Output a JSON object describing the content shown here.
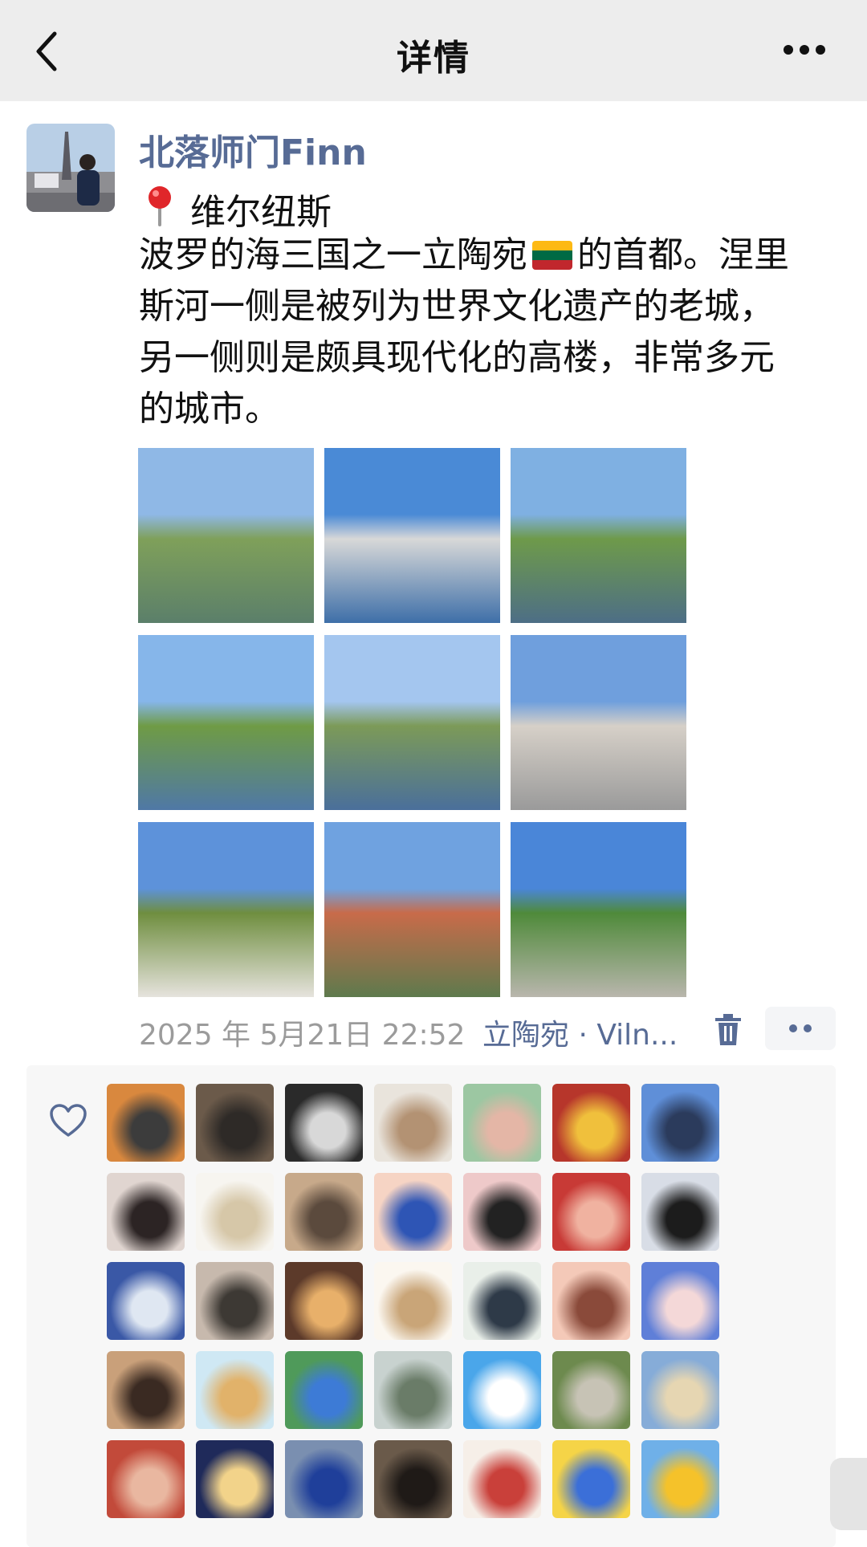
{
  "header": {
    "title": "详情"
  },
  "post": {
    "author": "北落师门Finn",
    "location": "维尔纽斯",
    "caption_lines": [
      {
        "before": "波罗的海三国之一立陶宛",
        "after": "的首都。涅里"
      },
      {
        "text": "斯河一侧是被列为世界文化遗产的老城，"
      },
      {
        "text": "另一侧则是颇具现代化的高楼，非常多元"
      },
      {
        "text": "的城市。"
      }
    ],
    "flag_colors": [
      "#fdb913",
      "#006a44",
      "#c1272d"
    ],
    "photos": [
      {
        "name": "photo-river-embankment",
        "sky": "#8fb8e6",
        "ground": "#5b7f6a",
        "accent": "#7fa05a"
      },
      {
        "name": "photo-city-skyscrapers",
        "sky": "#4a8ad6",
        "ground": "#3e6fa8",
        "accent": "#d8d8d8"
      },
      {
        "name": "photo-river-old-town",
        "sky": "#7fb0e2",
        "ground": "#4d6e86",
        "accent": "#6e9a4a"
      },
      {
        "name": "photo-river-bend",
        "sky": "#86b6ea",
        "ground": "#4f78a6",
        "accent": "#6f9b45"
      },
      {
        "name": "photo-river-reflection",
        "sky": "#a4c6ef",
        "ground": "#4a6f9b",
        "accent": "#7c9a58"
      },
      {
        "name": "photo-monument-building",
        "sky": "#6f9fdd",
        "ground": "#9a9a9a",
        "accent": "#d6d0c8"
      },
      {
        "name": "photo-castle-hill",
        "sky": "#5d92da",
        "ground": "#e6e3dd",
        "accent": "#6f8e3f"
      },
      {
        "name": "photo-city-panorama",
        "sky": "#6fa2e0",
        "ground": "#5e7a4d",
        "accent": "#c86b4a"
      },
      {
        "name": "photo-stone-sculptures",
        "sky": "#4a86d8",
        "ground": "#b9b6ad",
        "accent": "#4f8a3a"
      }
    ],
    "timestamp": "2025 年 5月21日 22:52",
    "location_link": "立陶宛 · Viln...",
    "likers": [
      [
        "#d9883e",
        "#3c3c3c"
      ],
      [
        "#6b5a4a",
        "#2e2a27"
      ],
      [
        "#2a2a2a",
        "#d8d8d8"
      ],
      [
        "#e9e4dc",
        "#b39273"
      ],
      [
        "#9cc7a2",
        "#e4b6a6"
      ],
      [
        "#b7362b",
        "#f0c03c"
      ],
      [
        "#5f8fd8",
        "#2b3b5c"
      ],
      [
        "#e0d5d0",
        "#2c2424"
      ],
      [
        "#f7f5f0",
        "#d6c7a8"
      ],
      [
        "#c7a98a",
        "#5b4a3d"
      ],
      [
        "#f6d4c4",
        "#2e55b5"
      ],
      [
        "#eec9c9",
        "#222222"
      ],
      [
        "#c83a36",
        "#f0b2a0"
      ],
      [
        "#d8dde6",
        "#1c1c1c"
      ],
      [
        "#3a58a6",
        "#dfe7f2"
      ],
      [
        "#c7b9ad",
        "#3d3934"
      ],
      [
        "#5c3a2a",
        "#e8b06a"
      ],
      [
        "#fbf7f0",
        "#c9a578"
      ],
      [
        "#e9efe9",
        "#2e3a48"
      ],
      [
        "#f4c9b8",
        "#8a4a3a"
      ],
      [
        "#5f7fd8",
        "#f4d8d8"
      ],
      [
        "#c9a07a",
        "#3a2a22"
      ],
      [
        "#cfe8f4",
        "#e1b26a"
      ],
      [
        "#4f9a5a",
        "#3d7bd6"
      ],
      [
        "#c8d2cf",
        "#6a7c68"
      ],
      [
        "#4aa6ea",
        "#ffffff"
      ],
      [
        "#6d8a4e",
        "#c7c3b5"
      ],
      [
        "#86acd8",
        "#e6d6b2"
      ],
      [
        "#c24a3a",
        "#e9b7a0"
      ],
      [
        "#1f2a5a",
        "#f2d38a"
      ],
      [
        "#7a8fb0",
        "#1f3f9a"
      ],
      [
        "#6a5a4a",
        "#1f1a17"
      ],
      [
        "#f6efe8",
        "#c9403a"
      ],
      [
        "#f5d447",
        "#3b6fd8"
      ],
      [
        "#6fb0e8",
        "#f5c22a"
      ]
    ]
  }
}
